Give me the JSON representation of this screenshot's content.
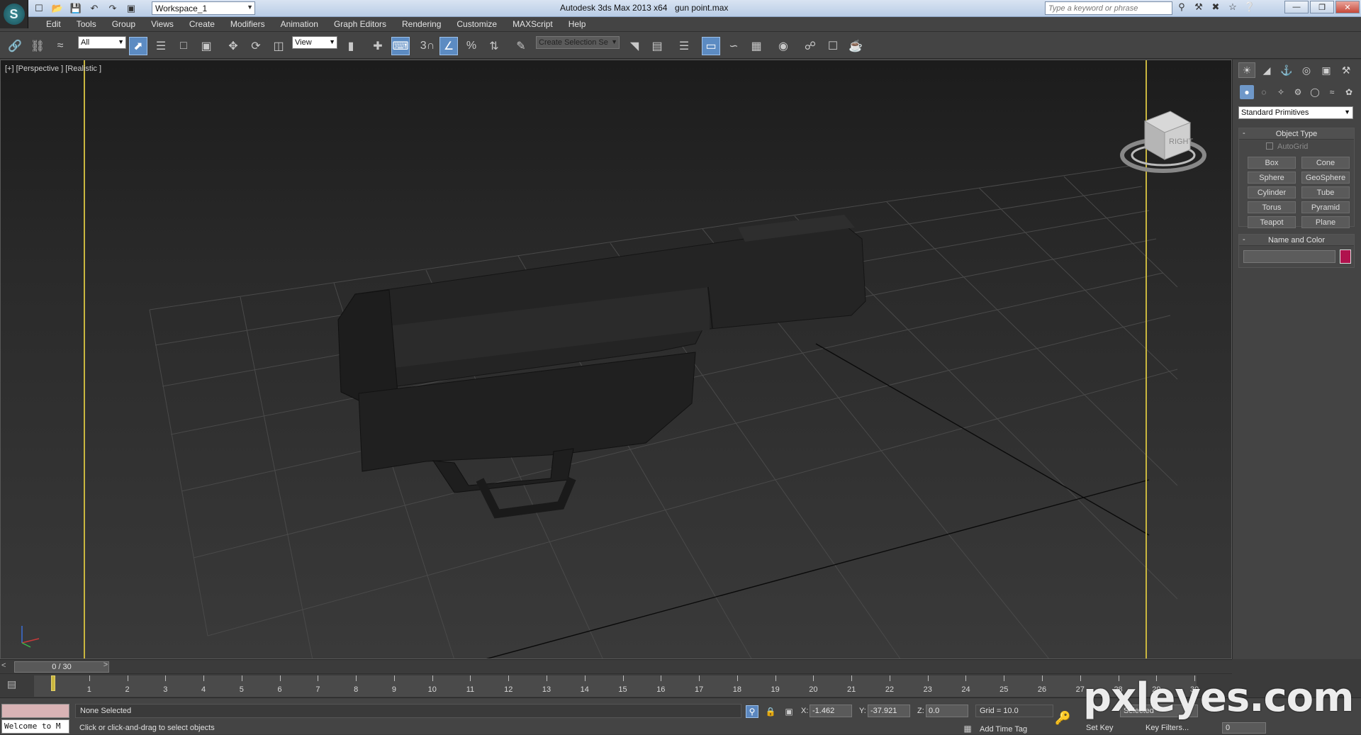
{
  "titlebar": {
    "workspace": "Workspace_1",
    "app_title": "Autodesk 3ds Max  2013 x64",
    "file_name": "gun point.max",
    "search_placeholder": "Type a keyword or phrase"
  },
  "menu": [
    "Edit",
    "Tools",
    "Group",
    "Views",
    "Create",
    "Modifiers",
    "Animation",
    "Graph Editors",
    "Rendering",
    "Customize",
    "MAXScript",
    "Help"
  ],
  "toolbar": {
    "selection_filter": "All",
    "ref_coord": "View",
    "named_selection": "Create Selection Se",
    "snap_label": "3"
  },
  "viewport": {
    "label": "[+] [Perspective ] [Realistic ]",
    "viewcube_face": "RIGHT"
  },
  "command_panel": {
    "category": "Standard Primitives",
    "object_type_title": "Object Type",
    "autogrid_label": "AutoGrid",
    "buttons": [
      "Box",
      "Cone",
      "Sphere",
      "GeoSphere",
      "Cylinder",
      "Tube",
      "Torus",
      "Pyramid",
      "Teapot",
      "Plane"
    ],
    "name_color_title": "Name and Color",
    "object_color": "#b0124d"
  },
  "timeline": {
    "slider_label": "0 / 30",
    "ticks": [
      "1",
      "2",
      "3",
      "4",
      "5",
      "6",
      "7",
      "8",
      "9",
      "10",
      "11",
      "12",
      "13",
      "14",
      "15",
      "16",
      "17",
      "18",
      "19",
      "20",
      "21",
      "22",
      "23",
      "24",
      "25",
      "26",
      "27",
      "28",
      "29",
      "30"
    ]
  },
  "status": {
    "welcome": "Welcome to M",
    "selection": "None Selected",
    "prompt": "Click or click-and-drag to select objects",
    "x_label": "X:",
    "x_value": "-1.462",
    "y_label": "Y:",
    "y_value": "-37.921",
    "z_label": "Z:",
    "z_value": "0.0",
    "grid": "Grid = 10.0",
    "add_time_tag": "Add Time Tag",
    "set_key": "Set Key",
    "key_filters": "Key Filters...",
    "selected_mode": "Selected",
    "current_frame": "0"
  },
  "watermark": "pxleyes.com"
}
